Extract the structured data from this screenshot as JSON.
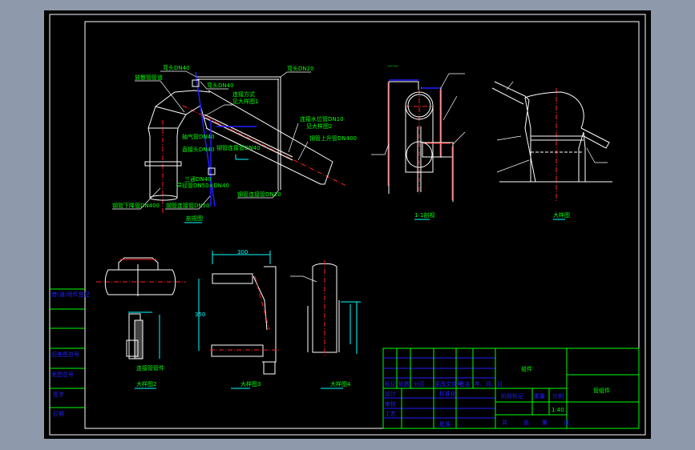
{
  "colors": {
    "background": "#8e9aab",
    "canvas": "#000000",
    "frame": "#ffffff",
    "label": "#00ff00",
    "table_text": "#2020ff",
    "dimension": "#00ffff",
    "centerline": "#ff2020"
  },
  "drawing_main": {
    "caption": "剖视图",
    "labels": [
      "弯头DN40",
      "放散管管道",
      "弯头DN40",
      "连接方式",
      "见大样图1",
      "弯头DN20",
      "连接水位管DN10",
      "见大样图2",
      "钢管上升管DN400",
      "抽气管DN40",
      "直接头DN40",
      "钢管连接管DN40",
      "三通DN40",
      "异径管DN50×DN40",
      "钢管下降管DN400",
      "钢管连接管DN50",
      "钢管连接管DN20"
    ]
  },
  "drawing_section": {
    "caption": "1-1剖视"
  },
  "drawing_detail1": {
    "caption": "大样图"
  },
  "detail2": {
    "caption": "大样图2",
    "sub_caption": "连接管管件"
  },
  "detail3": {
    "caption": "大样图3",
    "dimension": "300",
    "height_dim": "350"
  },
  "detail4": {
    "caption": "大样图4"
  },
  "left_strip": {
    "rows": [
      "借(通)用件登记",
      "旧底图总号",
      "底图总号",
      "签字",
      "日期"
    ]
  },
  "title_block": {
    "revision_headers": [
      "标记",
      "处数",
      "分区",
      "更改文件号",
      "签名",
      "年、月、日"
    ],
    "roles": [
      "设计",
      "标准化",
      "审核",
      "工艺",
      "批准"
    ],
    "drawing_name": "组件",
    "part_name": "管组件",
    "stage_headers": [
      "阶段标记",
      "重量",
      "比例"
    ],
    "scale": "1:40",
    "sheet": [
      "共",
      "张",
      "第",
      "张"
    ]
  }
}
